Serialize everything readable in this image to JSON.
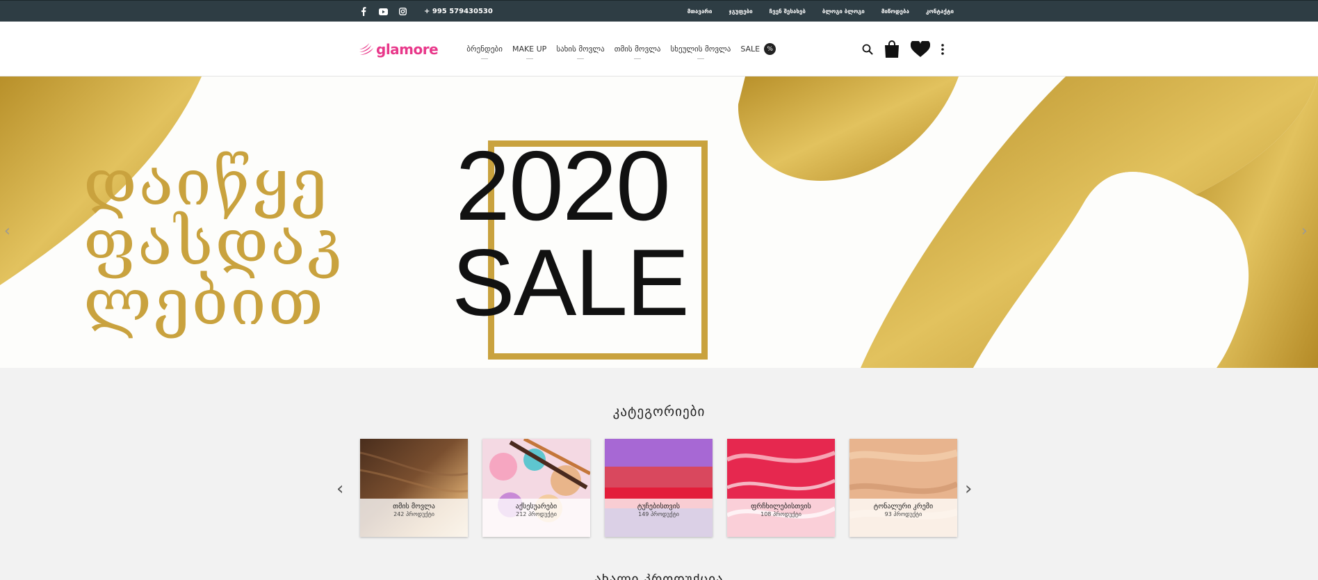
{
  "topbar": {
    "phone": "+ 995 579430530",
    "links": [
      "მთავარი",
      "ჯგუფები",
      "ჩვენ შესახებ",
      "ბლოგი ბლოგი",
      "მიწოდება",
      "კონტაქტი"
    ],
    "social_icons": [
      "facebook-icon",
      "youtube-icon",
      "instagram-icon"
    ]
  },
  "header": {
    "logo_text": "glamore",
    "nav": [
      {
        "label": "ბრენდები"
      },
      {
        "label": "MAKE UP"
      },
      {
        "label": "სახის მოვლა"
      },
      {
        "label": "თმის მოვლა"
      },
      {
        "label": "სხეულის მოვლა"
      },
      {
        "label": "SALE"
      }
    ],
    "sale_badge": "%",
    "action_icons": [
      "search-icon",
      "shopping-bag-icon",
      "heart-icon",
      "more-vertical-icon"
    ]
  },
  "hero": {
    "text_lines": [
      "დაიწყე",
      "ფასდაკ",
      "ლებით"
    ],
    "year": "2020",
    "sale": "SALE"
  },
  "categories": {
    "title": "კატეგორიები",
    "items": [
      {
        "name": "თმის მოვლა",
        "count": "242 პროდუქტი"
      },
      {
        "name": "აქსესუარები",
        "count": "212 პროდუქტი"
      },
      {
        "name": "ტუჩებისთვის",
        "count": "149 პროდუქტი"
      },
      {
        "name": "ფრჩხილებისთვის",
        "count": "108 პროდუქტი"
      },
      {
        "name": "ტონალური კრემი",
        "count": "93 პროდუქტი"
      }
    ],
    "next_title": "ახალი პროდუქცია"
  },
  "colors": {
    "gold": "#c9a23e",
    "brand_pink": "#e8388a",
    "topbar_bg": "#2e3d44"
  }
}
